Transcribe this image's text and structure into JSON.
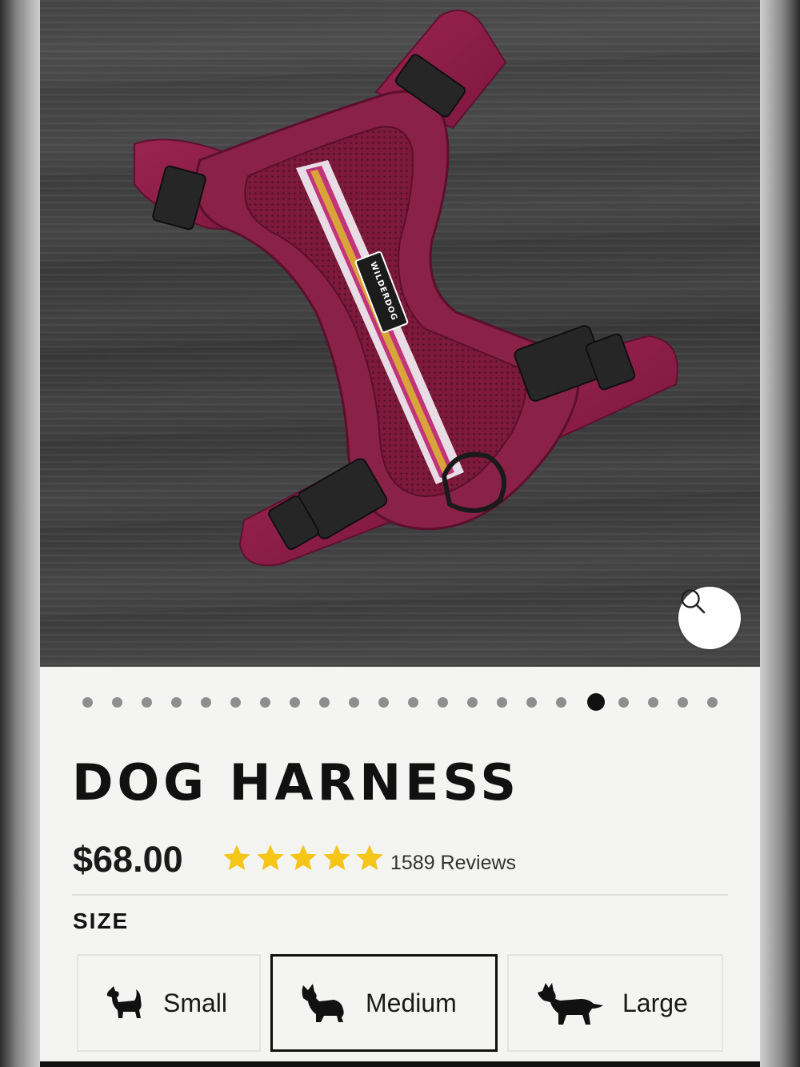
{
  "product": {
    "title": "DOG HARNESS",
    "price": "$68.00",
    "rating": 5,
    "rating_max": 5,
    "reviews_label": "1589 Reviews",
    "brand_tag": "WILDERDOG"
  },
  "gallery": {
    "image_count": 22,
    "active_index": 17
  },
  "size": {
    "label": "SIZE",
    "options": [
      {
        "label": "Small",
        "icon": "small-dog-icon",
        "selected": false
      },
      {
        "label": "Medium",
        "icon": "medium-dog-icon",
        "selected": true
      },
      {
        "label": "Large",
        "icon": "large-dog-icon",
        "selected": false
      }
    ]
  },
  "icons": {
    "zoom": "magnifier-icon",
    "rating": "star-icon"
  },
  "colors": {
    "harness": "#8c1f45",
    "star": "#f5c518",
    "active_dot": "#111111",
    "inactive_dot": "#8e8e8e"
  }
}
